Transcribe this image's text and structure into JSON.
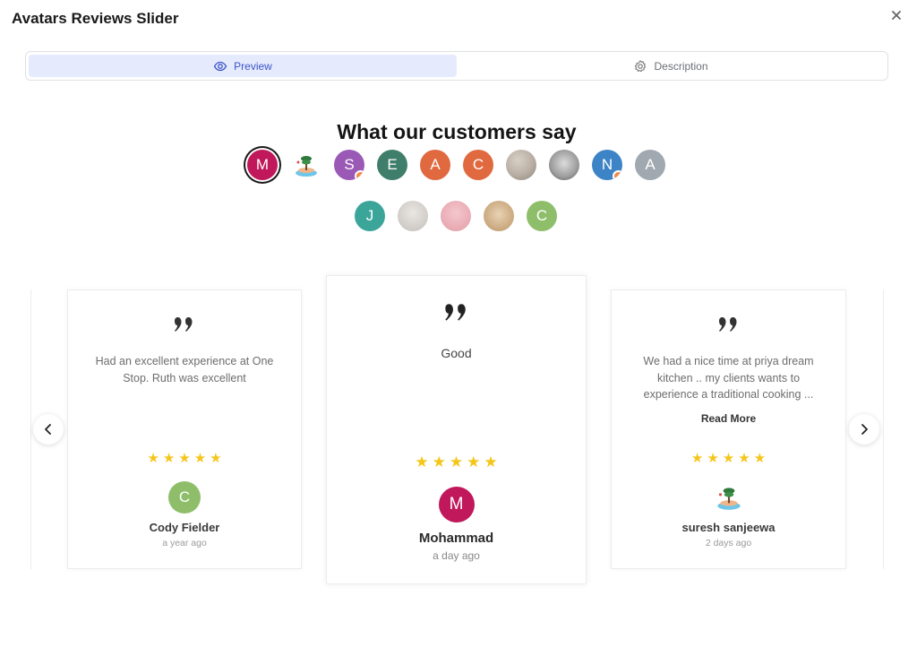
{
  "modal": {
    "title": "Avatars Reviews Slider"
  },
  "tabs": [
    {
      "label": "Preview",
      "icon": "eye-icon",
      "active": true
    },
    {
      "label": "Description",
      "icon": "gear-icon",
      "active": false
    }
  ],
  "section": {
    "title": "What our customers say"
  },
  "avatars": [
    {
      "initial": "M",
      "color": "#c0185a",
      "selected": true
    },
    {
      "initial": "",
      "image": "illustration-tree-island"
    },
    {
      "initial": "S",
      "color": "#9b59b6",
      "badge": true
    },
    {
      "initial": "E",
      "color": "#3f7e6a"
    },
    {
      "initial": "A",
      "color": "#e0693f"
    },
    {
      "initial": "C",
      "color": "#e0693f"
    },
    {
      "initial": "",
      "image": "photo"
    },
    {
      "initial": "",
      "image": "photo-night"
    },
    {
      "initial": "N",
      "color": "#3d84c6",
      "badge": true
    },
    {
      "initial": "A",
      "color": "#a0a8b0"
    },
    {
      "initial": "J",
      "color": "#3ba59a"
    },
    {
      "initial": "",
      "image": "photo-grey"
    },
    {
      "initial": "",
      "image": "photo-pink"
    },
    {
      "initial": "",
      "image": "photo-tan"
    },
    {
      "initial": "C",
      "color": "#8fbe6a"
    }
  ],
  "reviews": {
    "left": {
      "text": "Had an excellent experience at One Stop. Ruth was excellent",
      "stars": 5,
      "initial": "C",
      "avatar_color": "#8fbe6a",
      "name": "Cody Fielder",
      "time": "a year ago"
    },
    "center": {
      "text": "Good",
      "stars": 5,
      "initial": "M",
      "avatar_color": "#c0185a",
      "name": "Mohammad",
      "time": "a day ago"
    },
    "right": {
      "text": "We had a nice time at priya dream kitchen .. my clients wants to experience a traditional cooking ...",
      "read_more": "Read More",
      "stars": 5,
      "avatar_image": "illustration-tree-island",
      "name": "suresh sanjeewa",
      "time": "2 days ago"
    }
  },
  "colors": {
    "accent": "#3a55c8",
    "star": "#f5c518",
    "tab_active_bg": "#e6eafd"
  }
}
